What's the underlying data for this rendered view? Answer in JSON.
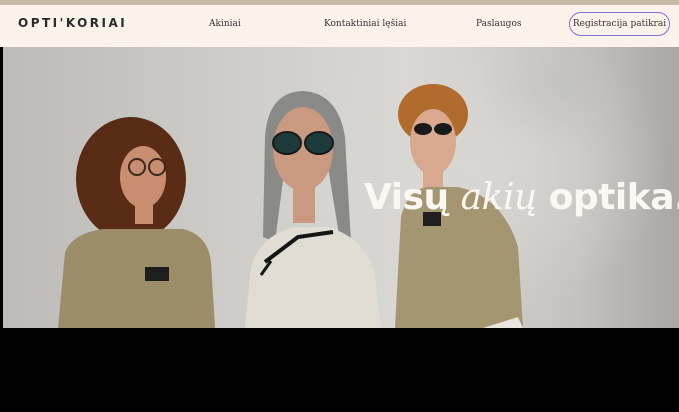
{
  "header": {
    "logo": "OPTI'KORIAI",
    "nav": [
      {
        "label": "Akiniai"
      },
      {
        "label": "Kontaktiniai lęšiai"
      },
      {
        "label": "Paslaugos"
      }
    ],
    "cta_label": "Registracija patikrai"
  },
  "hero": {
    "headline_part1": "Visų",
    "headline_italic": "akių",
    "headline_part2": "optika.",
    "image_description": "three models wearing khaki workwear and eyeglasses/sunglasses"
  },
  "colors": {
    "header_bg": "#fbf2ea",
    "cta_border": "#7a6ee0",
    "headline": "#fbf7f2",
    "footer_bg": "#000000"
  }
}
